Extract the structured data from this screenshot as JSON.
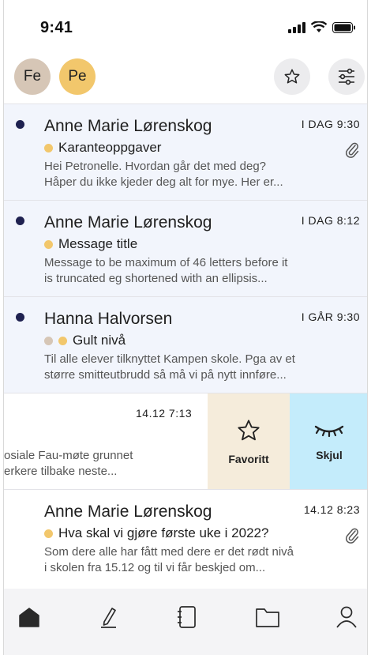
{
  "status_bar": {
    "time": "9:41"
  },
  "header": {
    "avatars": [
      {
        "initials": "Fe",
        "color": "#d6c6b6"
      },
      {
        "initials": "Pe",
        "color": "#f2c76c"
      }
    ],
    "favorites_icon": "star-icon",
    "filter_icon": "sliders-icon"
  },
  "messages": [
    {
      "sender": "Anne Marie Lørenskog",
      "time": "I DAG  9:30",
      "subject": "Karanteoppgaver",
      "preview_line1": "Hei Petronelle. Hvordan går det med deg?",
      "preview_line2": "Håper du ikke kjeder deg alt for mye. Her er...",
      "unread": true,
      "attachment": true,
      "category_color": "#f2c76c"
    },
    {
      "sender": "Anne Marie Lørenskog",
      "time": "I DAG  8:12",
      "subject": "Message title",
      "preview_line1": "Message to be maximum of 46 letters before it",
      "preview_line2": "is truncated eg shortened with an ellipsis...",
      "unread": true,
      "attachment": false,
      "category_color": "#f2c76c"
    },
    {
      "sender": "Hanna Halvorsen",
      "time": "I GÅR  9:30",
      "subject": "Gult nivå",
      "preview_line1": "Til alle elever tilknyttet Kampen skole. Pga av et",
      "preview_line2": "større smitteutbrudd så må vi på nytt innføre...",
      "unread": true,
      "attachment": false,
      "category_colors": [
        "#d6c6b6",
        "#f2c76c"
      ]
    },
    {
      "time": "14.12  7:13",
      "preview_line1": "osiale Fau-møte grunnet",
      "preview_line2": "erkere tilbake neste...",
      "swiped": true,
      "actions": [
        {
          "label": "Favoritt",
          "icon": "star-icon",
          "color": "#f5ecdb"
        },
        {
          "label": "Skjul",
          "icon": "closed-eye-icon",
          "color": "#c4ecfb"
        }
      ]
    },
    {
      "sender": "Anne Marie Lørenskog",
      "time": "14.12  8:23",
      "subject": "Hva skal vi gjøre første uke i 2022?",
      "preview_line1": "Som dere alle har fått med dere er det rødt nivå",
      "preview_line2": "i skolen fra 15.12 og til vi får beskjed om...",
      "unread": false,
      "attachment": true,
      "category_color": "#f2c76c"
    }
  ],
  "tabbar": {
    "tabs": [
      {
        "icon": "home-icon",
        "active": true
      },
      {
        "icon": "pen-icon",
        "active": false
      },
      {
        "icon": "notebook-icon",
        "active": false
      },
      {
        "icon": "folder-icon",
        "active": false
      },
      {
        "icon": "profile-icon",
        "active": false
      }
    ]
  }
}
